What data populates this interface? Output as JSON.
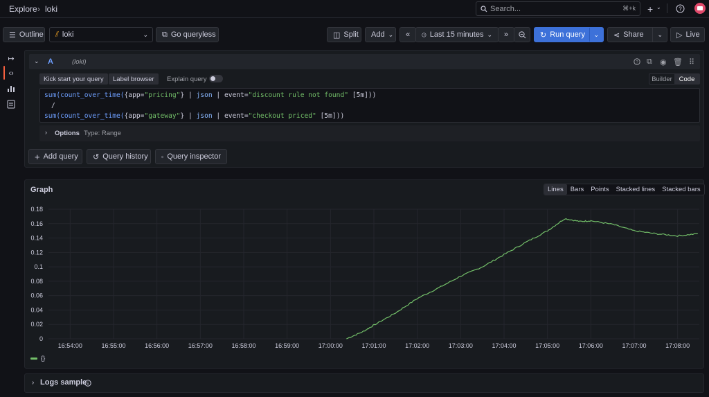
{
  "breadcrumb": {
    "parent": "Explore",
    "sep": "›",
    "current": "loki"
  },
  "search": {
    "placeholder": "Search...",
    "shortcut": "⌘+k"
  },
  "toolbar": {
    "outline": "Outline",
    "datasource": "loki",
    "go_queryless": "Go queryless",
    "split": "Split",
    "add": "Add",
    "time_range": "Last 15 minutes",
    "run_query": "Run query",
    "share": "Share",
    "live": "Live"
  },
  "query": {
    "letter": "A",
    "datasource_hint": "(loki)",
    "kick_start": "Kick start your query",
    "label_browser": "Label browser",
    "explain": "Explain query",
    "mode_builder": "Builder",
    "mode_code": "Code",
    "line1": {
      "fn": "sum(count_over_time(",
      "sel_open": "{app=",
      "str": "\"pricing\"",
      "rest1": "} | ",
      "json": "json",
      "rest2": " | event=",
      "str2": "\"discount rule not found\"",
      "tail": " [5m]))"
    },
    "line2": "/",
    "line3": {
      "fn": "sum(count_over_time(",
      "sel_open": "{app=",
      "str": "\"gateway\"",
      "rest1": "} | ",
      "json": "json",
      "rest2": " | event=",
      "str2": "\"checkout priced\"",
      "tail": " [5m]))"
    },
    "options_label": "Options",
    "options_type": "Type: Range"
  },
  "actions": {
    "add_query": "Add query",
    "history": "Query history",
    "inspector": "Query inspector"
  },
  "graph": {
    "title": "Graph",
    "modes": [
      "Lines",
      "Bars",
      "Points",
      "Stacked lines",
      "Stacked bars"
    ],
    "active_mode": "Lines"
  },
  "chart_data": {
    "type": "line",
    "title": "",
    "xlabel": "",
    "ylabel": "",
    "x_ticks": [
      "16:54:00",
      "16:55:00",
      "16:56:00",
      "16:57:00",
      "16:58:00",
      "16:59:00",
      "17:00:00",
      "17:01:00",
      "17:02:00",
      "17:03:00",
      "17:04:00",
      "17:05:00",
      "17:06:00",
      "17:07:00",
      "17:08:00"
    ],
    "y_ticks": [
      "0",
      "0.02",
      "0.04",
      "0.06",
      "0.08",
      "0.1",
      "0.12",
      "0.14",
      "0.16",
      "0.18"
    ],
    "ylim": [
      0,
      0.18
    ],
    "xlim": [
      "16:53:30",
      "17:08:30"
    ],
    "grid": true,
    "legend_position": "bottom-left",
    "series": [
      {
        "name": "{}",
        "color": "#73bf69",
        "x": [
          "17:00:22",
          "17:00:45",
          "17:01:00",
          "17:01:30",
          "17:02:00",
          "17:02:30",
          "17:03:00",
          "17:03:30",
          "17:04:00",
          "17:04:30",
          "17:05:00",
          "17:05:24",
          "17:05:45",
          "17:06:00",
          "17:06:30",
          "17:07:00",
          "17:07:30",
          "17:08:00",
          "17:08:28"
        ],
        "y": [
          0,
          0.01,
          0.019,
          0.036,
          0.056,
          0.071,
          0.087,
          0.1,
          0.117,
          0.134,
          0.15,
          0.167,
          0.163,
          0.164,
          0.159,
          0.15,
          0.146,
          0.143,
          0.146
        ]
      }
    ]
  },
  "legend": {
    "label": "{}"
  },
  "logs": {
    "label": "Logs sample"
  }
}
